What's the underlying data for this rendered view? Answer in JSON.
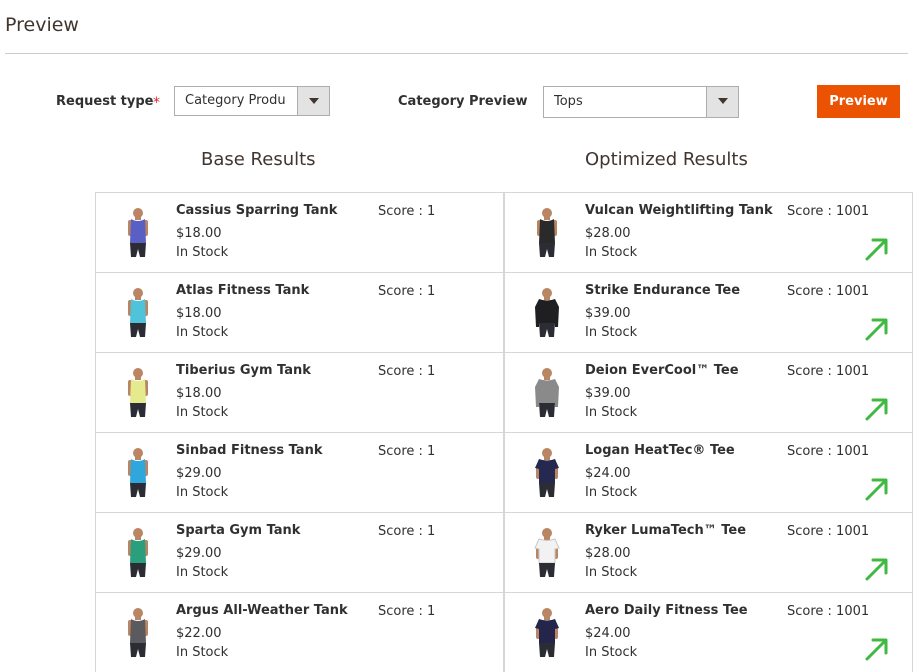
{
  "page": {
    "title": "Preview"
  },
  "form": {
    "request_type_label": "Request type",
    "required_mark": "*",
    "request_type_value": "Category Produ",
    "category_preview_label": "Category Preview",
    "category_preview_value": "Tops",
    "preview_button": "Preview"
  },
  "colors": {
    "accent": "#eb5202",
    "trend_up": "#3fb93f",
    "border": "#d6d6d6"
  },
  "base": {
    "heading": "Base Results",
    "items": [
      {
        "name": "Cassius Sparring Tank",
        "price": "$18.00",
        "stock": "In Stock",
        "score": "Score : 1",
        "shirt": "#5a5fc4",
        "shirt_type": "tank"
      },
      {
        "name": "Atlas Fitness Tank",
        "price": "$18.00",
        "stock": "In Stock",
        "score": "Score : 1",
        "shirt": "#4fc3d9",
        "shirt_type": "tank"
      },
      {
        "name": "Tiberius Gym Tank",
        "price": "$18.00",
        "stock": "In Stock",
        "score": "Score : 1",
        "shirt": "#e5ea8f",
        "shirt_type": "tank"
      },
      {
        "name": "Sinbad Fitness Tank",
        "price": "$29.00",
        "stock": "In Stock",
        "score": "Score : 1",
        "shirt": "#2fa6dc",
        "shirt_type": "tank"
      },
      {
        "name": "Sparta Gym Tank",
        "price": "$29.00",
        "stock": "In Stock",
        "score": "Score : 1",
        "shirt": "#2b9e7d",
        "shirt_type": "tank"
      },
      {
        "name": "Argus All-Weather Tank",
        "price": "$22.00",
        "stock": "In Stock",
        "score": "Score : 1",
        "shirt": "#5b5b5f",
        "shirt_type": "tank"
      }
    ]
  },
  "optimized": {
    "heading": "Optimized Results",
    "items": [
      {
        "name": "Vulcan Weightlifting Tank",
        "price": "$28.00",
        "stock": "In Stock",
        "score": "Score : 1001",
        "shirt": "#2a2a2a",
        "shirt_type": "tank",
        "trend": "arrow-up-right-icon"
      },
      {
        "name": "Strike Endurance Tee",
        "price": "$39.00",
        "stock": "In Stock",
        "score": "Score : 1001",
        "shirt": "#1f1f22",
        "shirt_type": "longsleeve",
        "trend": "arrow-up-right-icon"
      },
      {
        "name": "Deion EverCool™ Tee",
        "price": "$39.00",
        "stock": "In Stock",
        "score": "Score : 1001",
        "shirt": "#8a8a8a",
        "shirt_type": "longsleeve",
        "trend": "arrow-up-right-icon"
      },
      {
        "name": "Logan HeatTec® Tee",
        "price": "$24.00",
        "stock": "In Stock",
        "score": "Score : 1001",
        "shirt": "#26294f",
        "shirt_type": "tee",
        "trend": "arrow-up-right-icon"
      },
      {
        "name": "Ryker LumaTech™ Tee",
        "price": "$28.00",
        "stock": "In Stock",
        "score": "Score : 1001",
        "shirt": "#f2f2f2",
        "shirt_type": "tee",
        "trend": "arrow-up-right-icon"
      },
      {
        "name": "Aero Daily Fitness Tee",
        "price": "$24.00",
        "stock": "In Stock",
        "score": "Score : 1001",
        "shirt": "#23264a",
        "shirt_type": "tee",
        "trend": "arrow-up-right-icon"
      }
    ]
  }
}
